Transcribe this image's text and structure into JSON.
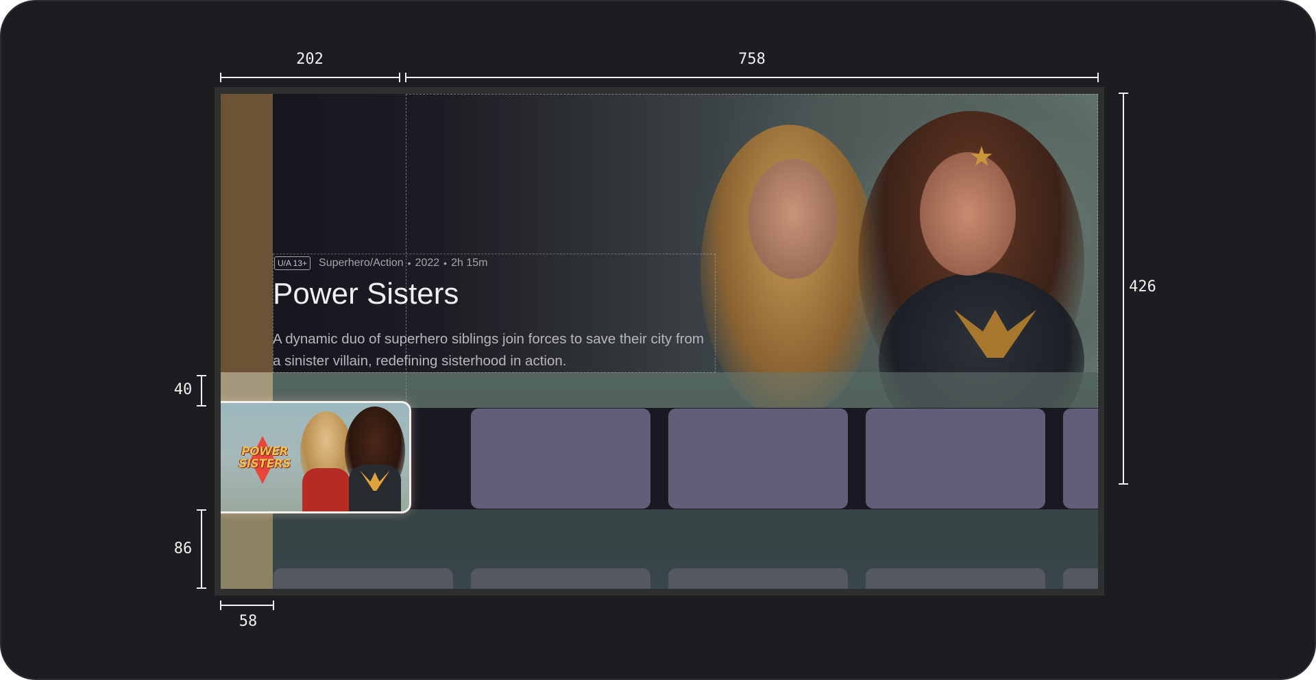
{
  "hero": {
    "rating": "U/A 13+",
    "genre": "Superhero/Action",
    "year": "2022",
    "duration": "2h 15m",
    "separator": "•",
    "title": "Power Sisters",
    "description": "A dynamic duo of superhero siblings join forces to save their city from a sinister villain, redefining sisterhood in action."
  },
  "featured_card": {
    "logo_line1": "POWER",
    "logo_line2": "SISTERS"
  },
  "annotations": {
    "nav_width": "202",
    "hero_width": "758",
    "hero_height": "426",
    "row_gap": "40",
    "bottom_peek": "86",
    "rail_width": "58"
  },
  "colors": {
    "frame": "#1c1d20",
    "card_placeholder": "#625d78",
    "nav_strip": "#6d5335",
    "focus_border": "#f4f0ee"
  }
}
